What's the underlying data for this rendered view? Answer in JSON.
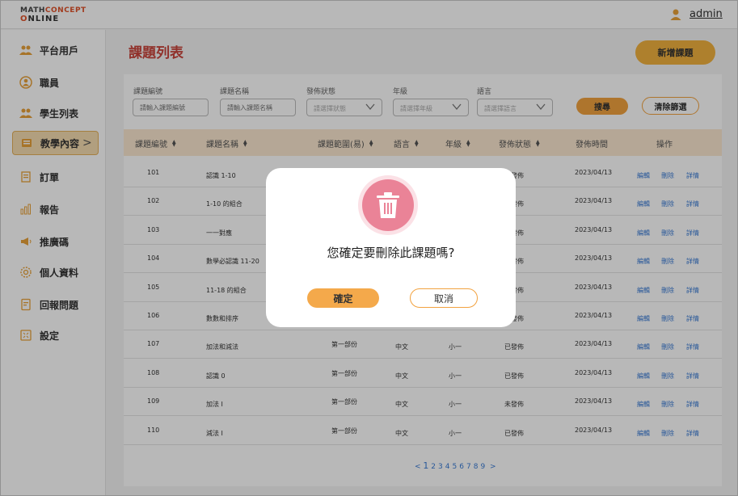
{
  "logo": {
    "line1_a": "MATH",
    "line1_b": "CONCEPT",
    "line2_a": "O",
    "line2_b": "NLINE"
  },
  "header": {
    "user": "admin"
  },
  "sidebar": {
    "items": [
      {
        "label": "平台用戶",
        "icon": "users-gear-icon"
      },
      {
        "label": "職員",
        "icon": "staff-icon"
      },
      {
        "label": "學生列表",
        "icon": "students-icon"
      },
      {
        "label": "教學內容",
        "icon": "book-icon",
        "active": true
      },
      {
        "label": "訂單",
        "icon": "order-icon"
      },
      {
        "label": "報告",
        "icon": "report-chart-icon"
      },
      {
        "label": "推廣碼",
        "icon": "megaphone-icon"
      },
      {
        "label": "個人資料",
        "icon": "profile-gear-icon"
      },
      {
        "label": "回報問題",
        "icon": "feedback-icon"
      },
      {
        "label": "設定",
        "icon": "settings-icon"
      }
    ],
    "chevron": ">"
  },
  "page": {
    "title": "課題列表",
    "add_button": "新增課題"
  },
  "filters": {
    "id_label": "課題編號",
    "id_placeholder": "請輸入課題編號",
    "name_label": "課題名稱",
    "name_placeholder": "請輸入課題名稱",
    "status_label": "發佈狀態",
    "status_placeholder": "請選擇狀態",
    "grade_label": "年級",
    "grade_placeholder": "請選擇年級",
    "lang_label": "語言",
    "lang_placeholder": "請選擇語言",
    "search_button": "搜尋",
    "clear_button": "清除篩選"
  },
  "table": {
    "headers": [
      "課題編號",
      "課題名稱",
      "課題範圍(易)",
      "語言",
      "年級",
      "發佈狀態",
      "發佈時間",
      "操作"
    ],
    "rows": [
      {
        "id": "101",
        "name": "認識 1-10",
        "range": "",
        "lang": "",
        "grade": "",
        "status": "未發佈",
        "date": "2023/04/13"
      },
      {
        "id": "102",
        "name": "1-10 的組合",
        "range": "",
        "lang": "",
        "grade": "",
        "status": "已發佈",
        "date": "2023/04/13"
      },
      {
        "id": "103",
        "name": "一一對應",
        "range": "",
        "lang": "",
        "grade": "",
        "status": "已發佈",
        "date": "2023/04/13"
      },
      {
        "id": "104",
        "name": "數學必認識 11-20",
        "range": "",
        "lang": "",
        "grade": "",
        "status": "未發佈",
        "date": "2023/04/13"
      },
      {
        "id": "105",
        "name": "11-18 的組合",
        "range": "",
        "lang": "",
        "grade": "",
        "status": "已發佈",
        "date": "2023/04/13"
      },
      {
        "id": "106",
        "name": "數數和排序",
        "range": "",
        "lang": "",
        "grade": "",
        "status": "已發佈",
        "date": "2023/04/13"
      },
      {
        "id": "107",
        "name": "加法和減法",
        "range": "第一部份",
        "lang": "中文",
        "grade": "小一",
        "status": "已發佈",
        "date": "2023/04/13"
      },
      {
        "id": "108",
        "name": "認識 0",
        "range": "第一部份",
        "lang": "中文",
        "grade": "小一",
        "status": "已發佈",
        "date": "2023/04/13"
      },
      {
        "id": "109",
        "name": "加法 I",
        "range": "第一部份",
        "lang": "中文",
        "grade": "小一",
        "status": "未發佈",
        "date": "2023/04/13"
      },
      {
        "id": "110",
        "name": "減法 I",
        "range": "第一部份",
        "lang": "中文",
        "grade": "小一",
        "status": "已發佈",
        "date": "2023/04/13"
      }
    ],
    "actions": {
      "edit": "編輯",
      "delete": "刪除",
      "detail": "詳情"
    }
  },
  "pagination": {
    "prev": "<",
    "current": "1",
    "pages": [
      "2",
      "3",
      "4",
      "5",
      "6",
      "7",
      "8",
      "9"
    ],
    "next": ">"
  },
  "modal": {
    "message": "您確定要刪除此課題嗎?",
    "confirm": "確定",
    "cancel": "取消",
    "icon": "trash-icon"
  },
  "colors": {
    "accent": "#f2a23f",
    "title": "#c9453c",
    "link": "#3a7bd5",
    "trash": "#ea8397"
  }
}
